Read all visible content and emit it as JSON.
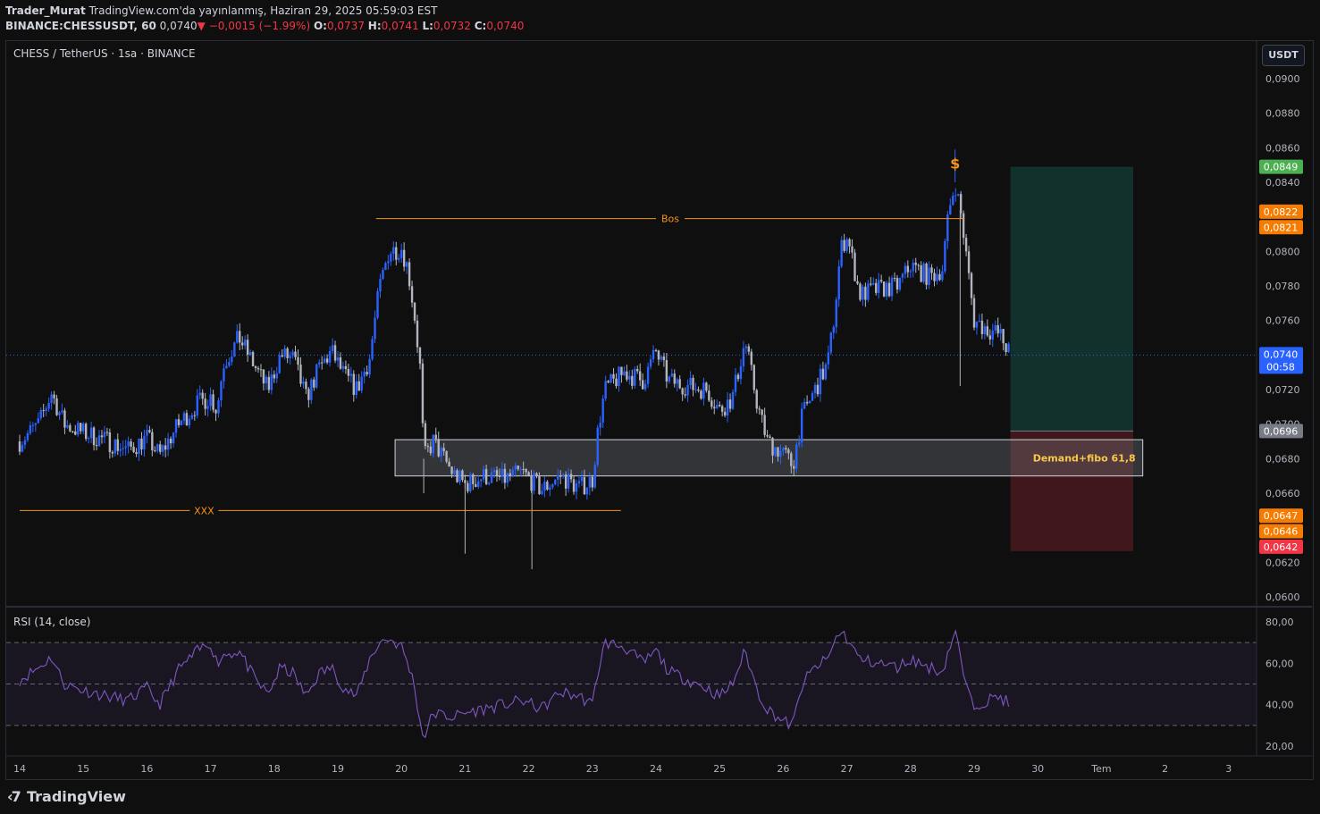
{
  "header": {
    "author": "Trader_Murat",
    "published": "TradingView.com'da yayınlanmış, Haziran 29, 2025 05:59:03 EST",
    "symbol": "BINANCE:CHESSUSDT, 60",
    "last": "0,0740",
    "change": "−0,0015 (−1.99%)",
    "o_label": "O:",
    "o_val": "0,0737",
    "h_label": "H:",
    "h_val": "0,0741",
    "l_label": "L:",
    "l_val": "0,0732",
    "c_label": "C:",
    "c_val": "0,0740",
    "down_arrow": "▼"
  },
  "symbol_title": "CHESS / TetherUS · 1sa · BINANCE",
  "currency_button": "USDT",
  "rsi_title": "RSI (14, close)",
  "logo_text": "TradingView",
  "colors": {
    "bg": "#0f0f0f",
    "up": "#2962ff",
    "down": "#b2b5be",
    "orange": "#f7931a",
    "rsi": "#7e57c2",
    "tp": "#22ab94",
    "sl": "#f23645"
  },
  "chart_data": {
    "type": "candlestick",
    "price_axis": {
      "ticks": [
        "0,0900",
        "0,0880",
        "0,0860",
        "0,0840",
        "0,0800",
        "0,0780",
        "0,0760",
        "0,0720",
        "0,0700",
        "0,0680",
        "0,0660",
        "0,0620",
        "0,0600"
      ],
      "ylim": [
        0.06,
        0.0908
      ]
    },
    "x_axis": {
      "ticks": [
        "14",
        "15",
        "16",
        "17",
        "18",
        "19",
        "20",
        "21",
        "22",
        "23",
        "24",
        "25",
        "26",
        "27",
        "28",
        "29",
        "30",
        "Tem",
        "2",
        "3"
      ]
    },
    "price_labels": [
      {
        "text": "0,0849",
        "kind": "tp",
        "price": 0.0849
      },
      {
        "text": "0,0822",
        "kind": "orange",
        "price": 0.0823
      },
      {
        "text": "0,0821",
        "kind": "orange",
        "price": 0.0814
      },
      {
        "text": "0,0740",
        "kind": "current",
        "price": 0.074,
        "sub": "00:58"
      },
      {
        "text": "0,0696",
        "kind": "grey",
        "price": 0.0696
      },
      {
        "text": "0,0647",
        "kind": "orange",
        "price": 0.0647
      },
      {
        "text": "0,0646",
        "kind": "orange",
        "price": 0.0638
      },
      {
        "text": "0,0642",
        "kind": "sl",
        "price": 0.0629
      }
    ],
    "annotations": {
      "bos": {
        "text": "Bos",
        "price": 0.0819,
        "from_day": 19.6,
        "to_day": 28.85
      },
      "xxx": {
        "text": "XXX",
        "price": 0.065,
        "from_day": 14.0,
        "to_day": 23.45
      },
      "demand": {
        "text": "Demand+fibo 61,8",
        "top": 0.0691,
        "bottom": 0.067,
        "from_day": 19.9,
        "to_day": 31.65
      },
      "dollar": {
        "text": "$",
        "day": 28.7,
        "price": 0.0849
      },
      "position": {
        "entry": 0.0696,
        "tp": 0.0849,
        "sl": 0.0642,
        "from_day": 29.57,
        "to_day": 31.5
      }
    },
    "rsi": {
      "ticks": [
        "80,00",
        "60,00",
        "40,00",
        "20,00"
      ],
      "upper": 70,
      "mid": 50,
      "lower": 30,
      "ylim": [
        15,
        85
      ]
    },
    "price_path": [
      [
        14.0,
        0.069
      ],
      [
        14.3,
        0.07
      ],
      [
        14.5,
        0.0718
      ],
      [
        14.7,
        0.07
      ],
      [
        15.0,
        0.0695
      ],
      [
        15.4,
        0.069
      ],
      [
        15.7,
        0.0685
      ],
      [
        16.0,
        0.0692
      ],
      [
        16.2,
        0.0682
      ],
      [
        16.5,
        0.07
      ],
      [
        16.8,
        0.0712
      ],
      [
        17.0,
        0.0716
      ],
      [
        17.1,
        0.0708
      ],
      [
        17.2,
        0.0735
      ],
      [
        17.45,
        0.075
      ],
      [
        17.7,
        0.0733
      ],
      [
        17.9,
        0.072
      ],
      [
        18.1,
        0.074
      ],
      [
        18.3,
        0.0738
      ],
      [
        18.5,
        0.0715
      ],
      [
        18.7,
        0.0732
      ],
      [
        18.9,
        0.0742
      ],
      [
        19.1,
        0.0728
      ],
      [
        19.3,
        0.072
      ],
      [
        19.5,
        0.0738
      ],
      [
        19.65,
        0.0778
      ],
      [
        19.8,
        0.08
      ],
      [
        20.0,
        0.0802
      ],
      [
        20.1,
        0.079
      ],
      [
        20.2,
        0.0765
      ],
      [
        20.3,
        0.073
      ],
      [
        20.35,
        0.068
      ],
      [
        20.5,
        0.069
      ],
      [
        20.8,
        0.0672
      ],
      [
        21.0,
        0.0665
      ],
      [
        21.3,
        0.067
      ],
      [
        21.6,
        0.0668
      ],
      [
        21.9,
        0.0672
      ],
      [
        22.2,
        0.0662
      ],
      [
        22.5,
        0.067
      ],
      [
        22.8,
        0.0663
      ],
      [
        23.0,
        0.0668
      ],
      [
        23.1,
        0.07
      ],
      [
        23.2,
        0.072
      ],
      [
        23.5,
        0.073
      ],
      [
        23.8,
        0.0725
      ],
      [
        24.0,
        0.0742
      ],
      [
        24.2,
        0.0725
      ],
      [
        24.5,
        0.0722
      ],
      [
        24.8,
        0.072
      ],
      [
        25.0,
        0.0708
      ],
      [
        25.2,
        0.0715
      ],
      [
        25.4,
        0.0748
      ],
      [
        25.6,
        0.071
      ],
      [
        25.75,
        0.069
      ],
      [
        26.0,
        0.0683
      ],
      [
        26.15,
        0.0676
      ],
      [
        26.3,
        0.0705
      ],
      [
        26.5,
        0.072
      ],
      [
        26.7,
        0.0735
      ],
      [
        26.8,
        0.0762
      ],
      [
        26.9,
        0.08
      ],
      [
        27.0,
        0.081
      ],
      [
        27.2,
        0.0775
      ],
      [
        27.5,
        0.0778
      ],
      [
        27.8,
        0.078
      ],
      [
        28.0,
        0.0792
      ],
      [
        28.3,
        0.0785
      ],
      [
        28.5,
        0.079
      ],
      [
        28.6,
        0.0822
      ],
      [
        28.7,
        0.084
      ],
      [
        28.8,
        0.082
      ],
      [
        28.9,
        0.079
      ],
      [
        29.0,
        0.076
      ],
      [
        29.2,
        0.0755
      ],
      [
        29.4,
        0.0752
      ],
      [
        29.57,
        0.074
      ]
    ],
    "rsi_path": [
      [
        14.0,
        52
      ],
      [
        14.3,
        58
      ],
      [
        14.5,
        63
      ],
      [
        14.7,
        50
      ],
      [
        15.0,
        47
      ],
      [
        15.4,
        44
      ],
      [
        15.7,
        42
      ],
      [
        16.0,
        48
      ],
      [
        16.2,
        40
      ],
      [
        16.5,
        57
      ],
      [
        16.8,
        66
      ],
      [
        17.0,
        70
      ],
      [
        17.1,
        60
      ],
      [
        17.2,
        64
      ],
      [
        17.45,
        66
      ],
      [
        17.7,
        52
      ],
      [
        17.9,
        45
      ],
      [
        18.1,
        58
      ],
      [
        18.3,
        55
      ],
      [
        18.5,
        44
      ],
      [
        18.7,
        55
      ],
      [
        18.9,
        58
      ],
      [
        19.1,
        48
      ],
      [
        19.3,
        44
      ],
      [
        19.5,
        62
      ],
      [
        19.65,
        70
      ],
      [
        19.8,
        72
      ],
      [
        20.0,
        68
      ],
      [
        20.1,
        60
      ],
      [
        20.2,
        50
      ],
      [
        20.3,
        30
      ],
      [
        20.35,
        24
      ],
      [
        20.5,
        36
      ],
      [
        20.8,
        34
      ],
      [
        21.0,
        36
      ],
      [
        21.3,
        38
      ],
      [
        21.6,
        40
      ],
      [
        21.9,
        42
      ],
      [
        22.2,
        38
      ],
      [
        22.5,
        46
      ],
      [
        22.8,
        44
      ],
      [
        23.0,
        40
      ],
      [
        23.1,
        58
      ],
      [
        23.2,
        70
      ],
      [
        23.5,
        68
      ],
      [
        23.8,
        60
      ],
      [
        24.0,
        66
      ],
      [
        24.2,
        56
      ],
      [
        24.5,
        52
      ],
      [
        24.8,
        48
      ],
      [
        25.0,
        44
      ],
      [
        25.2,
        50
      ],
      [
        25.4,
        66
      ],
      [
        25.6,
        46
      ],
      [
        25.75,
        38
      ],
      [
        26.0,
        32
      ],
      [
        26.15,
        30
      ],
      [
        26.3,
        50
      ],
      [
        26.5,
        58
      ],
      [
        26.7,
        62
      ],
      [
        26.8,
        70
      ],
      [
        26.9,
        76
      ],
      [
        27.0,
        72
      ],
      [
        27.2,
        62
      ],
      [
        27.5,
        60
      ],
      [
        27.8,
        58
      ],
      [
        28.0,
        62
      ],
      [
        28.3,
        58
      ],
      [
        28.5,
        56
      ],
      [
        28.6,
        66
      ],
      [
        28.7,
        76
      ],
      [
        28.8,
        60
      ],
      [
        28.9,
        45
      ],
      [
        29.0,
        40
      ],
      [
        29.2,
        42
      ],
      [
        29.4,
        44
      ],
      [
        29.57,
        40
      ]
    ]
  }
}
